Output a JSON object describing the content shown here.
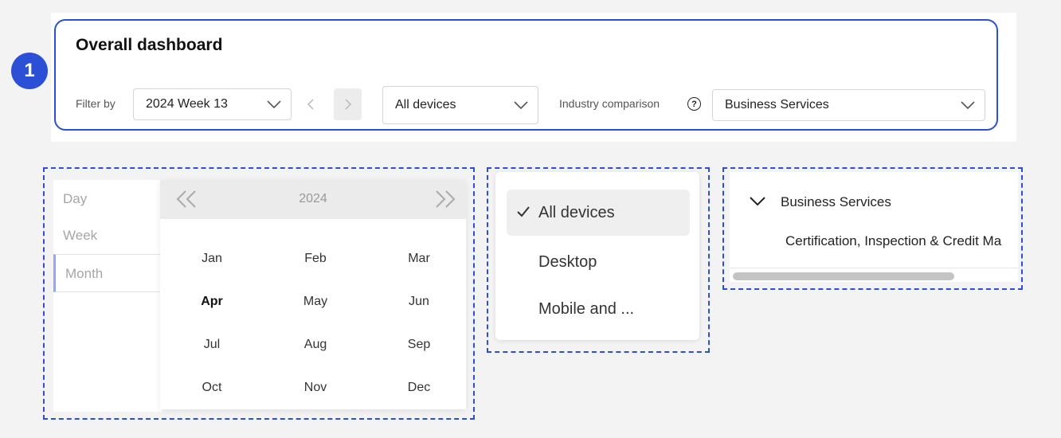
{
  "step_badge": "1",
  "header": {
    "title": "Overall dashboard",
    "filter_label": "Filter by",
    "week_value": "2024 Week 13",
    "device_value": "All devices",
    "industry_label": "Industry comparison",
    "help_icon": "question-circle-icon",
    "industry_value": "Business Services"
  },
  "calendar": {
    "granularity": [
      "Day",
      "Week",
      "Month"
    ],
    "selected_granularity": "Month",
    "year": "2024",
    "months": [
      "Jan",
      "Feb",
      "Mar",
      "Apr",
      "May",
      "Jun",
      "Jul",
      "Aug",
      "Sep",
      "Oct",
      "Nov",
      "Dec"
    ],
    "selected_month": "Apr"
  },
  "device_dropdown": {
    "options": [
      "All devices",
      "Desktop",
      "Mobile and ..."
    ],
    "selected": "All devices"
  },
  "industry_tree": {
    "parent": "Business Services",
    "child": "Certification, Inspection & Credit Ma"
  },
  "colors": {
    "accent": "#2b50d6",
    "selected_bg": "#efefef",
    "muted_text": "#a6a6a6"
  }
}
